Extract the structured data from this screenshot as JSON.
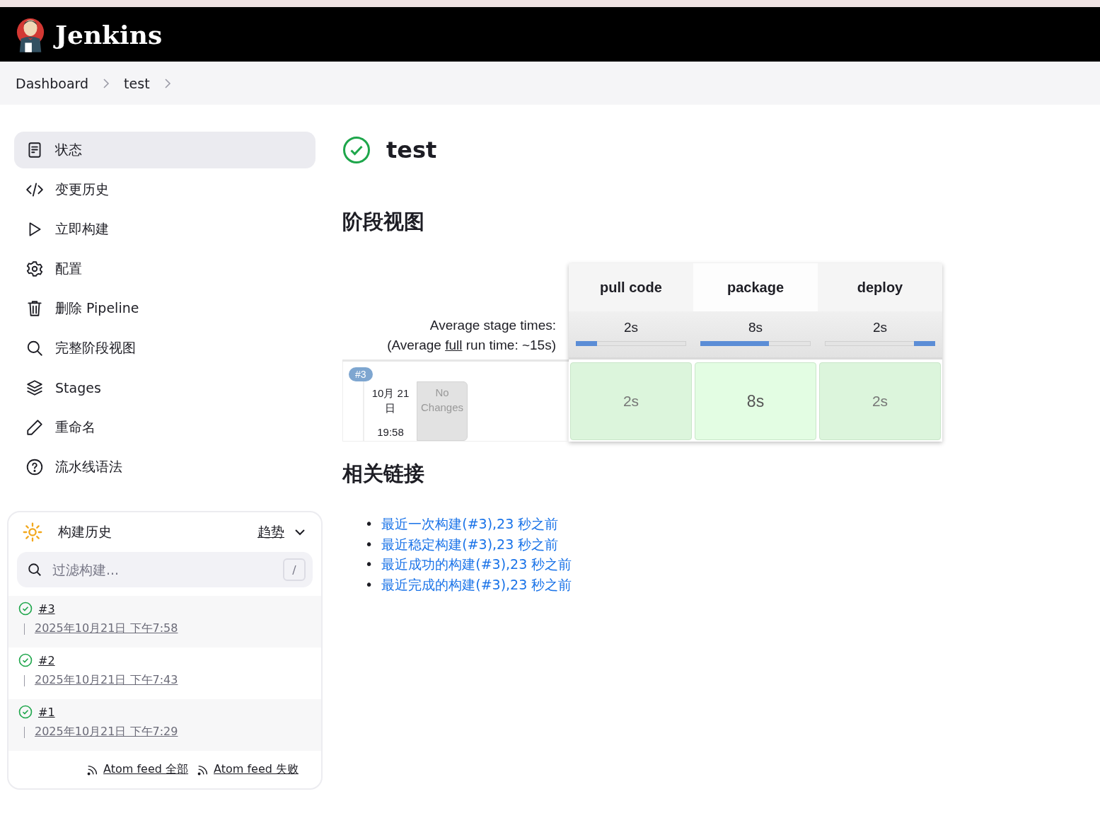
{
  "header": {
    "brand": "Jenkins"
  },
  "breadcrumbs": [
    "Dashboard",
    "test"
  ],
  "sidebar": {
    "items": [
      {
        "label": "状态",
        "selected": true
      },
      {
        "label": "变更历史",
        "selected": false
      },
      {
        "label": "立即构建",
        "selected": false
      },
      {
        "label": "配置",
        "selected": false
      },
      {
        "label": "删除 Pipeline",
        "selected": false
      },
      {
        "label": "完整阶段视图",
        "selected": false
      },
      {
        "label": "Stages",
        "selected": false
      },
      {
        "label": "重命名",
        "selected": false
      },
      {
        "label": "流水线语法",
        "selected": false
      }
    ]
  },
  "build_history": {
    "title": "构建历史",
    "trend": "趋势",
    "filter": {
      "placeholder": "过滤构建...",
      "shortcut": "/"
    },
    "builds": [
      {
        "number": "#3",
        "time": "2025年10月21日 下午7:58"
      },
      {
        "number": "#2",
        "time": "2025年10月21日 下午7:43"
      },
      {
        "number": "#1",
        "time": "2025年10月21日 下午7:29"
      }
    ],
    "feeds": [
      "Atom feed 全部",
      "Atom feed 失败"
    ]
  },
  "project": {
    "title": "test"
  },
  "stage_view": {
    "heading": "阶段视图",
    "avg_label": "Average stage times:",
    "avg_run_prefix": "(Average ",
    "avg_run_link": "full",
    "avg_run_suffix": " run time: ~15s)",
    "stages": [
      {
        "name": "pull code",
        "avg": "2s",
        "level": 0.19
      },
      {
        "name": "package",
        "avg": "8s",
        "level": 0.62
      },
      {
        "name": "deploy",
        "avg": "2s",
        "level": 0.19
      }
    ],
    "runs": [
      {
        "badge": "#3",
        "date": "10月 21\n日",
        "time": "19:58",
        "changes": "No Changes",
        "cells": [
          "2s",
          "8s",
          "2s"
        ]
      }
    ]
  },
  "related_links": {
    "heading": "相关链接",
    "links": [
      {
        "bullet": "•",
        "text": "最近一次构建(#3),23 秒之前"
      },
      {
        "bullet": "•",
        "text": "最近稳定构建(#3),23 秒之前"
      },
      {
        "bullet": "•",
        "text": "最近成功的构建(#3),23 秒之前"
      },
      {
        "bullet": "•",
        "text": "最近完成的构建(#3),23 秒之前"
      }
    ]
  }
}
